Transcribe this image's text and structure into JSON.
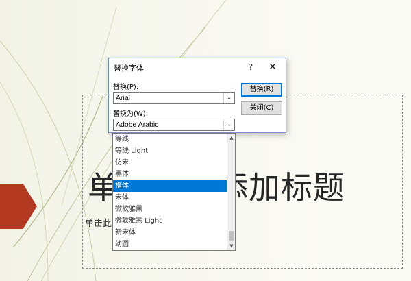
{
  "slide": {
    "title": "单击此处添加标题",
    "subtitle": "单击此处添加副标题"
  },
  "dialog": {
    "title": "替换字体",
    "help": "?",
    "close": "✕",
    "replace_label": "替换(P):",
    "replace_value": "Arial",
    "replace_with_label": "替换为(W):",
    "replace_with_value": "Adobe Arabic",
    "replace_button": "替换(R)",
    "close_button": "关闭(C)",
    "arrow": "⌄"
  },
  "dropdown": {
    "items": [
      "等线",
      "等线 Light",
      "仿宋",
      "黑体",
      "楷体",
      "宋体",
      "微软雅黑",
      "微软雅黑 Light",
      "新宋体",
      "幼圆"
    ],
    "selected_index": 4,
    "scroll_up": "▲",
    "scroll_down": "▼"
  },
  "colors": {
    "accent": "#b2381f",
    "selection": "#0078d7"
  }
}
